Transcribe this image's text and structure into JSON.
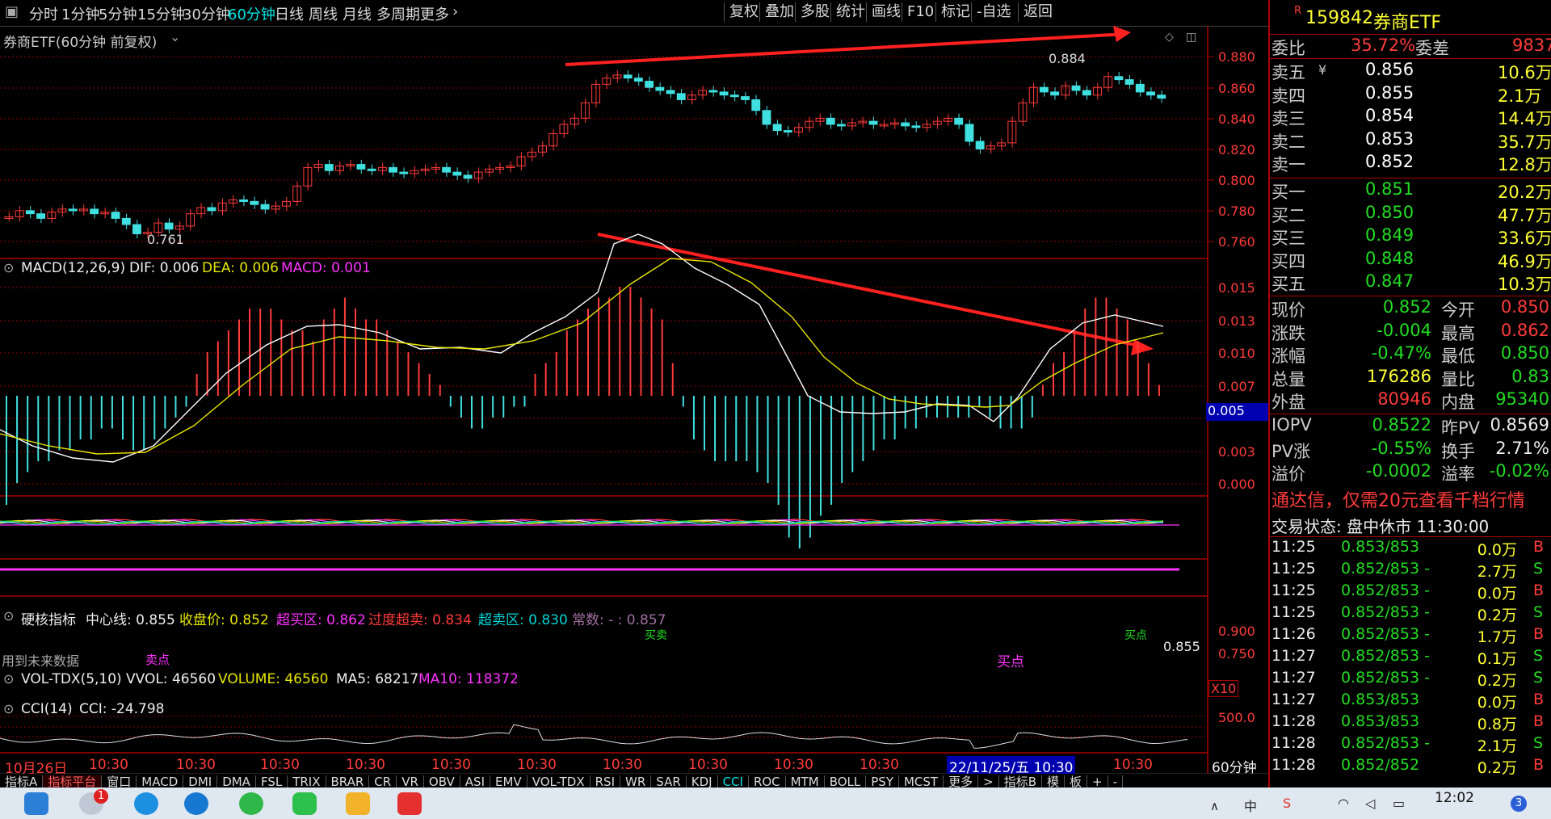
{
  "toolbar": {
    "timeframes": [
      "分时",
      "1分钟",
      "5分钟",
      "15分钟",
      "30分钟",
      "60分钟",
      "日线",
      "周线",
      "月线",
      "多周期",
      "更多"
    ],
    "active_timeframe": "60分钟",
    "right_buttons": [
      "复权",
      "叠加",
      "多股",
      "统计",
      "画线",
      "F10",
      "标记",
      "-自选",
      "返回"
    ]
  },
  "main_chart": {
    "title": "券商ETF(60分钟 前复权)",
    "price_axis": [
      "0.880",
      "0.860",
      "0.840",
      "0.820",
      "0.800",
      "0.780",
      "0.760"
    ],
    "high_label": "0.884",
    "low_label": "0.761"
  },
  "macd": {
    "header": "MACD(12,26,9)",
    "dif": "DIF: 0.006",
    "dea": "DEA: 0.006",
    "macd": "MACD: 0.001",
    "axis": [
      "0.015",
      "0.013",
      "0.010",
      "0.007",
      "0.005",
      "0.003",
      "0.000"
    ],
    "current_tag": "0.005"
  },
  "hard": {
    "header": "硬核指标",
    "center": "中心线: 0.855",
    "close": "收盘价: 0.852",
    "overbought": "超买区: 0.862",
    "over_overbought": "过度超卖: 0.834",
    "oversold": "超卖区: 0.830",
    "const": "常数: - : 0.857",
    "axis": [
      "0.900",
      "0.750"
    ],
    "value_tag": "0.855",
    "future_note": "用到未来数据",
    "sell_label": "卖点",
    "buy_label": "买点",
    "small_a": "买卖",
    "small_b": "买点"
  },
  "vol": {
    "header": "VOL-TDX(5,10)",
    "vvol": "VVOL: 46560",
    "volume": "VOLUME: 46560",
    "ma5": "MA5: 68217",
    "ma10": "MA10: 118372",
    "x10": "X10"
  },
  "cci": {
    "header": "CCI(14)",
    "value": "CCI: -24.798",
    "axis": "500.0"
  },
  "time_axis": {
    "labels": [
      "10月26日",
      "10:30",
      "10:30",
      "10:30",
      "10:30",
      "10:30",
      "10:30",
      "10:30",
      "10:30",
      "10:30",
      "10:30",
      "10:30"
    ],
    "highlight": "22/11/25/五 10:30",
    "last": "10:30",
    "period": "60分钟"
  },
  "bottom_tabs": [
    "指标A",
    "指标平台",
    "窗口",
    "MACD",
    "DMI",
    "DMA",
    "FSL",
    "TRIX",
    "BRAR",
    "CR",
    "VR",
    "OBV",
    "ASI",
    "EMV",
    "VOL-TDX",
    "RSI",
    "WR",
    "SAR",
    "KDJ",
    "CCI",
    "ROC",
    "MTM",
    "BOLL",
    "PSY",
    "MCST",
    "更多",
    ">",
    "指标B",
    "模",
    "板",
    "+",
    "-"
  ],
  "active_tab": "CCI",
  "quote": {
    "code": "159842",
    "name": "券商ETF",
    "r_mark": "R",
    "weibi_label": "委比",
    "weibi": "35.72%",
    "weicha_label": "委差",
    "weicha": "9837",
    "sells": [
      {
        "label": "卖五",
        "price": "0.856",
        "vol": "10.6万"
      },
      {
        "label": "卖四",
        "price": "0.855",
        "vol": "2.1万"
      },
      {
        "label": "卖三",
        "price": "0.854",
        "vol": "14.4万"
      },
      {
        "label": "卖二",
        "price": "0.853",
        "vol": "35.7万"
      },
      {
        "label": "卖一",
        "price": "0.852",
        "vol": "12.8万"
      }
    ],
    "buys": [
      {
        "label": "买一",
        "price": "0.851",
        "vol": "20.2万"
      },
      {
        "label": "买二",
        "price": "0.850",
        "vol": "47.7万"
      },
      {
        "label": "买三",
        "price": "0.849",
        "vol": "33.6万"
      },
      {
        "label": "买四",
        "price": "0.848",
        "vol": "46.9万"
      },
      {
        "label": "买五",
        "price": "0.847",
        "vol": "10.3万"
      }
    ],
    "stats": [
      {
        "l": "现价",
        "v": "0.852",
        "l2": "今开",
        "v2": "0.850"
      },
      {
        "l": "涨跌",
        "v": "-0.004",
        "l2": "最高",
        "v2": "0.862"
      },
      {
        "l": "涨幅",
        "v": "-0.47%",
        "l2": "最低",
        "v2": "0.850"
      },
      {
        "l": "总量",
        "v": "176286",
        "l2": "量比",
        "v2": "0.83"
      },
      {
        "l": "外盘",
        "v": "80946",
        "l2": "内盘",
        "v2": "95340"
      }
    ],
    "iopv": [
      {
        "l": "IOPV",
        "v": "0.8522",
        "l2": "昨PV",
        "v2": "0.8569"
      },
      {
        "l": "PV涨",
        "v": "-0.55%",
        "l2": "换手",
        "v2": "2.71%"
      },
      {
        "l": "溢价",
        "v": "-0.0002",
        "l2": "溢率",
        "v2": "-0.02%"
      }
    ],
    "promo": "通达信，仅需20元查看千档行情",
    "trade_status": "交易状态: 盘中休市 11:30:00",
    "ticks": [
      {
        "t": "11:25",
        "p": "0.853/853",
        "v": "0.0万",
        "s": "B"
      },
      {
        "t": "11:25",
        "p": "0.852/853 -",
        "v": "2.7万",
        "s": "S"
      },
      {
        "t": "11:25",
        "p": "0.852/853 -",
        "v": "0.0万",
        "s": "B"
      },
      {
        "t": "11:25",
        "p": "0.852/853 -",
        "v": "0.2万",
        "s": "S"
      },
      {
        "t": "11:26",
        "p": "0.852/853 -",
        "v": "1.7万",
        "s": "B"
      },
      {
        "t": "11:27",
        "p": "0.852/853 -",
        "v": "0.1万",
        "s": "S"
      },
      {
        "t": "11:27",
        "p": "0.852/853 -",
        "v": "0.2万",
        "s": "S"
      },
      {
        "t": "11:27",
        "p": "0.853/853",
        "v": "0.0万",
        "s": "B"
      },
      {
        "t": "11:28",
        "p": "0.853/853",
        "v": "0.8万",
        "s": "B"
      },
      {
        "t": "11:28",
        "p": "0.852/853 -",
        "v": "2.1万",
        "s": "S"
      },
      {
        "t": "11:28",
        "p": "0.852/852",
        "v": "0.2万",
        "s": "B"
      }
    ]
  },
  "taskbar": {
    "clock": "12:02",
    "badge": "1",
    "notif": "3"
  },
  "colors": {
    "up": "#ff3b3b",
    "down": "#40e0e0",
    "bg": "#000000",
    "dif": "#ffffff",
    "dea": "#e6e600",
    "grid": "#8b0000"
  }
}
